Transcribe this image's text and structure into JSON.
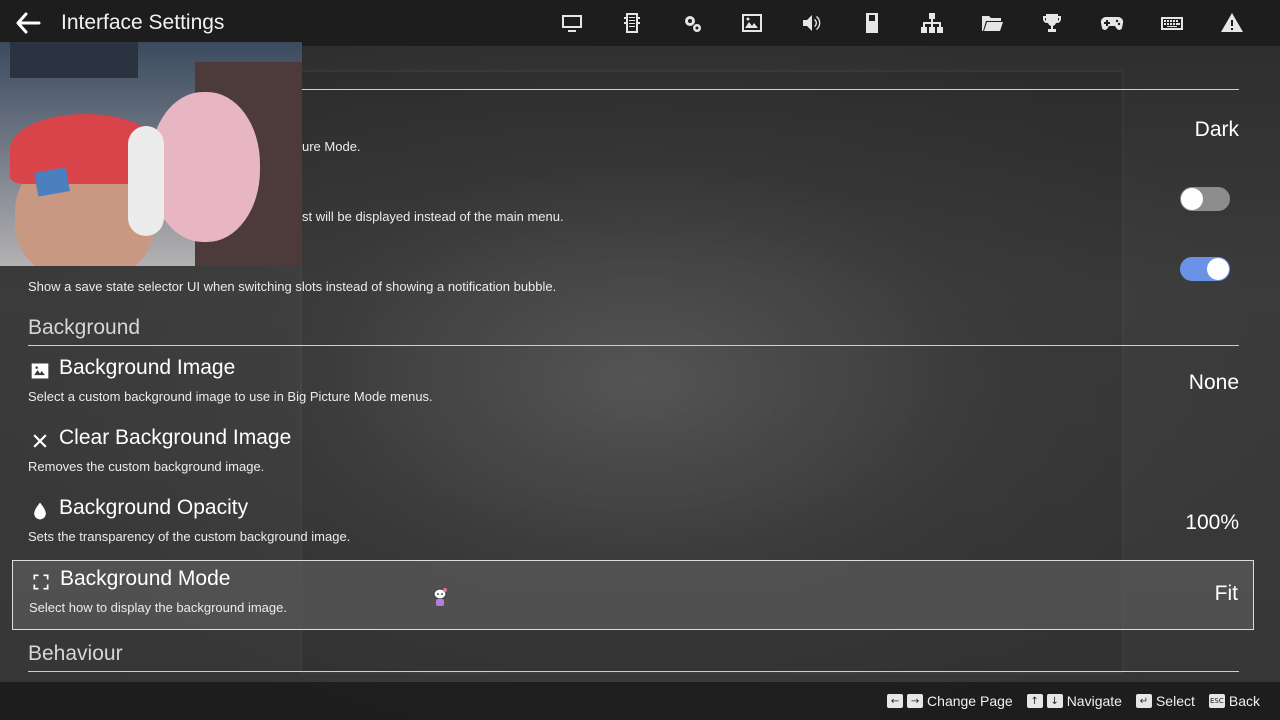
{
  "header": {
    "title": "Interface Settings",
    "nav_icons": [
      "monitor-icon",
      "memory-card-icon",
      "cpu-settings-icon",
      "image-icon",
      "speaker-icon",
      "card-slot-icon",
      "network-icon",
      "folder-icon",
      "trophy-icon",
      "gamepad-icon",
      "keyboard-icon",
      "warning-icon"
    ]
  },
  "settings": {
    "theme": {
      "desc_fragment": "ure Mode.",
      "value": "Dark"
    },
    "game_list": {
      "desc_fragment": "st will be displayed instead of the main menu.",
      "enabled": false
    },
    "save_state_selector": {
      "desc": "Show a save state selector UI when switching slots instead of showing a notification bubble.",
      "enabled": true
    }
  },
  "sections": {
    "background": "Background",
    "behaviour": "Behaviour"
  },
  "background_rows": [
    {
      "icon": "image-icon",
      "title": "Background Image",
      "desc": "Select a custom background image to use in Big Picture Mode menus.",
      "value": "None"
    },
    {
      "icon": "close-icon",
      "title": "Clear Background Image",
      "desc": "Removes the custom background image.",
      "value": ""
    },
    {
      "icon": "droplet-icon",
      "title": "Background Opacity",
      "desc": "Sets the transparency of the custom background image.",
      "value": "100%"
    },
    {
      "icon": "fullscreen-icon",
      "title": "Background Mode",
      "desc": "Select how to display the background image.",
      "value": "Fit"
    }
  ],
  "footer": {
    "hints": [
      {
        "keys": [
          "←",
          "→"
        ],
        "label": "Change Page"
      },
      {
        "keys": [
          "↑",
          "↓"
        ],
        "label": "Navigate"
      },
      {
        "keys": [
          "↵"
        ],
        "label": "Select"
      },
      {
        "keys": [
          "ESC"
        ],
        "label": "Back"
      }
    ]
  },
  "colors": {
    "accent_toggle": "#6a93e8",
    "header_bg": "#1c1c1c"
  }
}
